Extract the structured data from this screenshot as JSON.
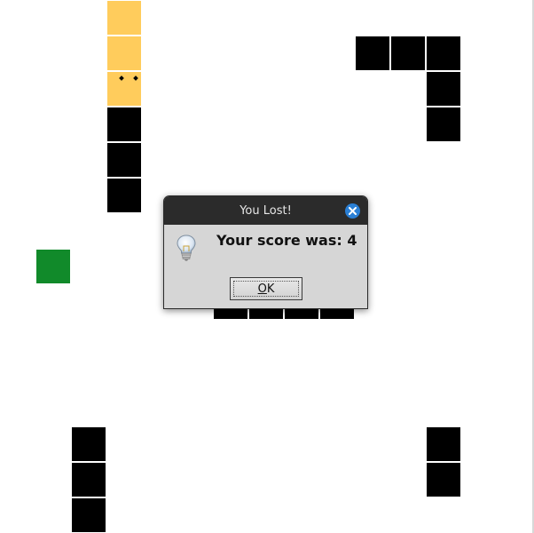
{
  "game": {
    "name": "snake",
    "score": 4,
    "colors": {
      "background": "#ffffff",
      "wall": "#000000",
      "snake": "#ffcc5c",
      "food": "#118a2a"
    }
  },
  "dialog": {
    "title": "You Lost!",
    "message": "Your score was: 4",
    "ok_label_mnemonic": "O",
    "ok_label_rest": "K",
    "icon": "lightbulb-icon",
    "close_icon": "close-icon"
  }
}
